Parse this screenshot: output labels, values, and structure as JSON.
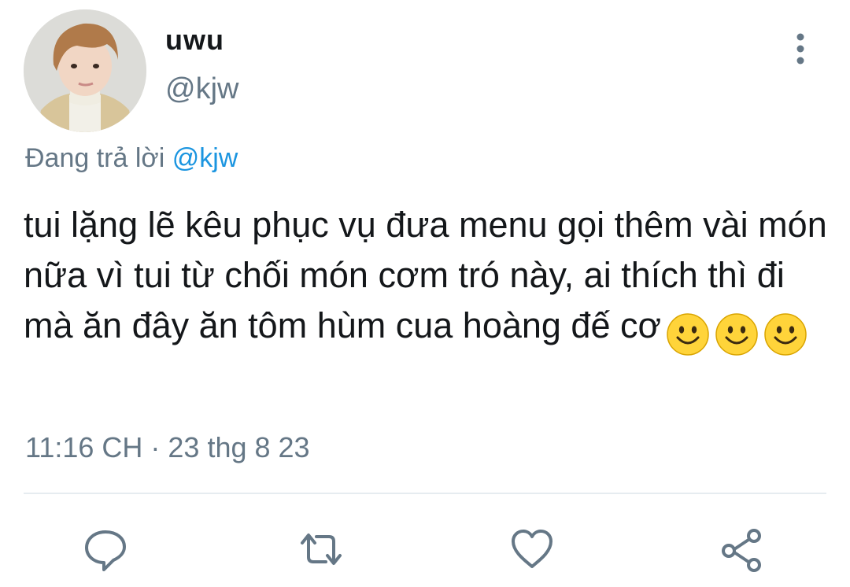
{
  "user": {
    "display_name": "uwu",
    "handle": "@kjw",
    "avatar_icon": "profile-photo"
  },
  "reply": {
    "prefix": "Đang trả lời",
    "mention": "@kjw"
  },
  "tweet": {
    "text": "tui lặng lẽ kêu phục vụ đưa menu gọi thêm vài món nữa vì tui từ chối món cơm tró này, ai thích thì đi mà ăn đây ăn tôm hùm cua hoàng đế cơ",
    "emojis": [
      "slightly-smiling-face",
      "slightly-smiling-face",
      "slightly-smiling-face"
    ],
    "timestamp": "11:16 CH · 23 thg 8 23"
  },
  "actions": [
    {
      "name": "reply",
      "icon": "comment-icon"
    },
    {
      "name": "retweet",
      "icon": "retweet-icon"
    },
    {
      "name": "like",
      "icon": "heart-icon"
    },
    {
      "name": "share",
      "icon": "share-icon"
    }
  ],
  "colors": {
    "text": "#14171a",
    "secondary": "#657786",
    "link": "#1b95e0",
    "divider": "#e6ecf0",
    "emoji_yellow": "#ffd43a"
  }
}
